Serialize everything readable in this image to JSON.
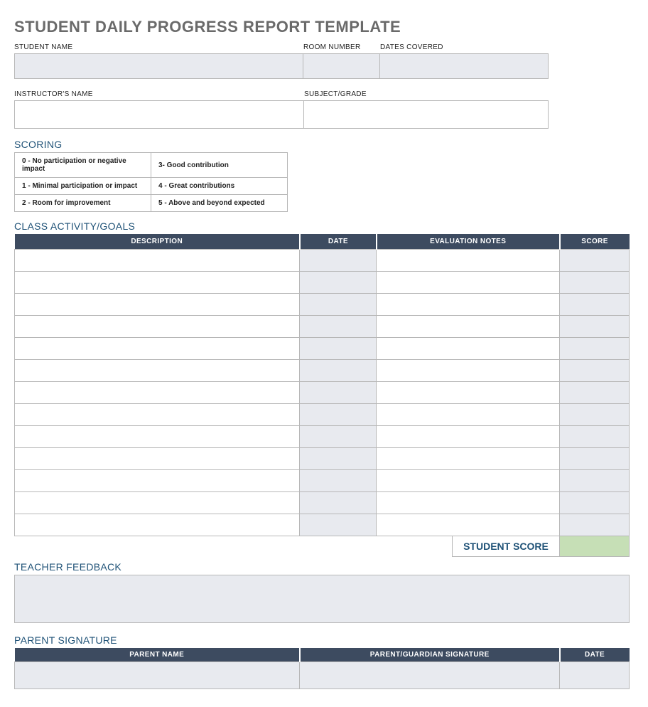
{
  "title": "STUDENT DAILY PROGRESS REPORT TEMPLATE",
  "fields": {
    "student_name_label": "STUDENT NAME",
    "student_name_value": "",
    "room_number_label": "ROOM NUMBER",
    "room_number_value": "",
    "dates_covered_label": "DATES COVERED",
    "dates_covered_value": "",
    "instructor_name_label": "INSTRUCTOR'S NAME",
    "instructor_name_value": "",
    "subject_grade_label": "SUBJECT/GRADE",
    "subject_grade_value": ""
  },
  "scoring": {
    "header": "SCORING",
    "rows": [
      {
        "left": "0 - No participation or negative impact",
        "right": "3- Good contribution"
      },
      {
        "left": "1 - Minimal participation or impact",
        "right": "4 - Great contributions"
      },
      {
        "left": "2 - Room for improvement",
        "right": "5 - Above and beyond expected"
      }
    ]
  },
  "activity": {
    "header": "CLASS ACTIVITY/GOALS",
    "columns": {
      "description": "DESCRIPTION",
      "date": "DATE",
      "notes": "EVALUATION NOTES",
      "score": "SCORE"
    },
    "rows": [
      {
        "description": "",
        "date": "",
        "notes": "",
        "score": ""
      },
      {
        "description": "",
        "date": "",
        "notes": "",
        "score": ""
      },
      {
        "description": "",
        "date": "",
        "notes": "",
        "score": ""
      },
      {
        "description": "",
        "date": "",
        "notes": "",
        "score": ""
      },
      {
        "description": "",
        "date": "",
        "notes": "",
        "score": ""
      },
      {
        "description": "",
        "date": "",
        "notes": "",
        "score": ""
      },
      {
        "description": "",
        "date": "",
        "notes": "",
        "score": ""
      },
      {
        "description": "",
        "date": "",
        "notes": "",
        "score": ""
      },
      {
        "description": "",
        "date": "",
        "notes": "",
        "score": ""
      },
      {
        "description": "",
        "date": "",
        "notes": "",
        "score": ""
      },
      {
        "description": "",
        "date": "",
        "notes": "",
        "score": ""
      },
      {
        "description": "",
        "date": "",
        "notes": "",
        "score": ""
      },
      {
        "description": "",
        "date": "",
        "notes": "",
        "score": ""
      }
    ],
    "student_score_label": "STUDENT SCORE",
    "student_score_value": ""
  },
  "feedback": {
    "header": "TEACHER FEEDBACK",
    "value": ""
  },
  "parent": {
    "header": "PARENT SIGNATURE",
    "columns": {
      "name": "PARENT NAME",
      "signature": "PARENT/GUARDIAN SIGNATURE",
      "date": "DATE"
    },
    "name_value": "",
    "signature_value": "",
    "date_value": ""
  }
}
